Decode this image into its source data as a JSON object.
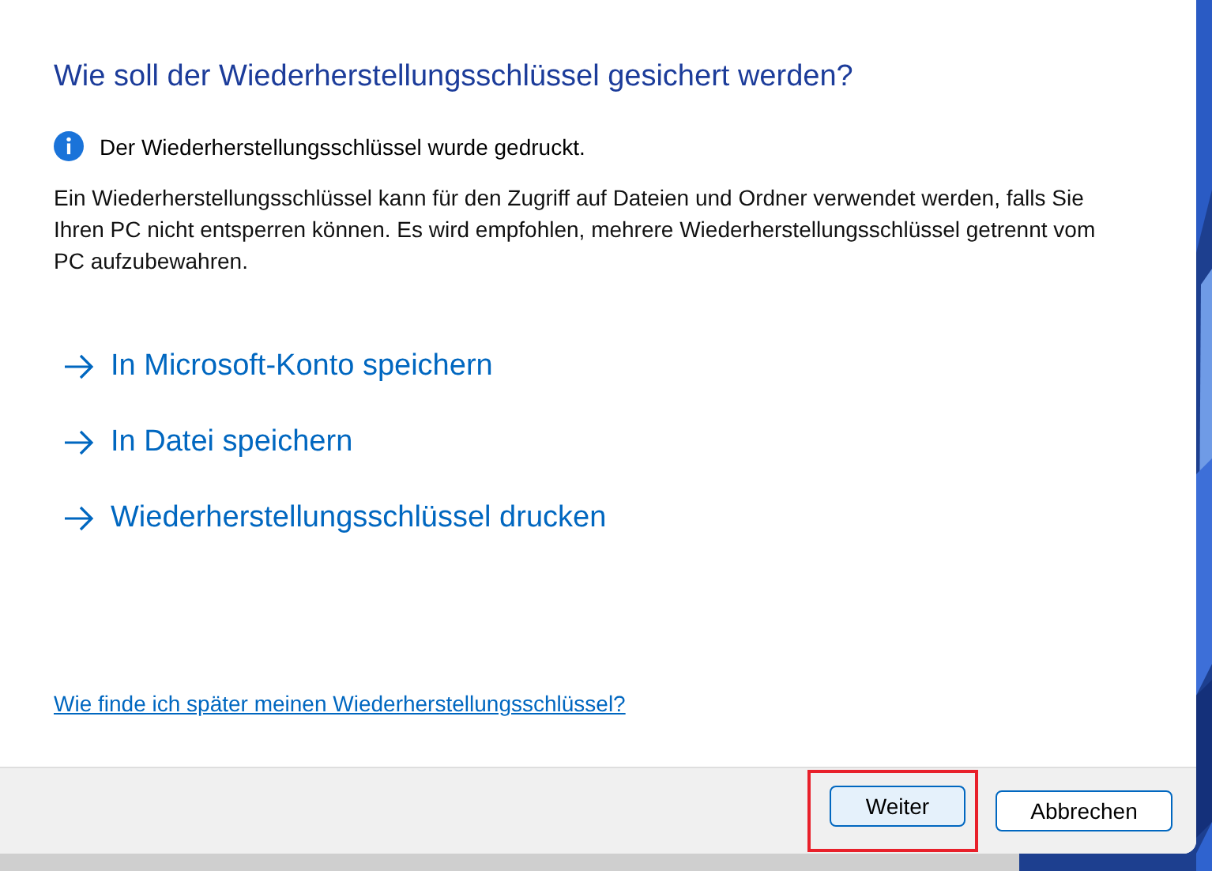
{
  "dialog": {
    "title": "Wie soll der Wiederherstellungsschlüssel gesichert werden?",
    "info": {
      "kind": "info",
      "text": "Der Wiederherstellungsschlüssel wurde gedruckt."
    },
    "description": "Ein Wiederherstellungsschlüssel kann für den Zugriff auf Dateien und Ordner verwendet werden, falls Sie Ihren PC nicht entsperren können. Es wird empfohlen, mehrere Wiederherstellungsschlüssel getrennt vom PC aufzubewahren.",
    "options": [
      {
        "label": "In Microsoft-Konto speichern"
      },
      {
        "label": "In Datei speichern"
      },
      {
        "label": "Wiederherstellungsschlüssel drucken"
      }
    ],
    "help_link": "Wie finde ich später meinen Wiederherstellungsschlüssel?",
    "buttons": [
      {
        "label": "Weiter",
        "primary": true,
        "highlighted": true
      },
      {
        "label": "Abbrechen",
        "primary": false,
        "highlighted": false
      }
    ]
  }
}
